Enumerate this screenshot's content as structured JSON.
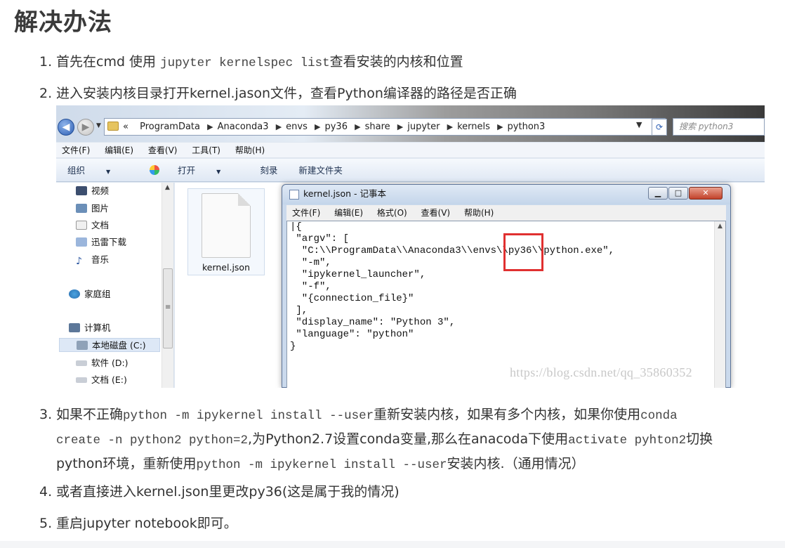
{
  "heading": "解决办法",
  "steps": {
    "s1": {
      "num": "1.",
      "pre": "首先在cmd 使用",
      "code": "jupyter kernelspec list",
      "post": "查看安装的内核和位置"
    },
    "s2": {
      "num": "2.",
      "text": "进入安装内核目录打开kernel.jason文件，查看Python编译器的路径是否正确"
    },
    "s3": {
      "num": "3.",
      "a": "如果不正确",
      "code1": "python -m ipykernel install --user",
      "b": "重新安装内核，如果有多个内核，如果你使用",
      "code2a": "conda",
      "code2b": "create -n python2 python=2",
      "c": ",为Python2.7设置conda变量,那么在anacoda下使用",
      "code3": "activate pyhton2",
      "d": "切换",
      "e": "python环境，重新使用",
      "code4": "python -m ipykernel install --user",
      "f": "安装内核.（通用情况）"
    },
    "s4": {
      "num": "4.",
      "text": "或者直接进入kernel.json里更改py36(这是属于我的情况)"
    },
    "s5": {
      "num": "5.",
      "text": "重启jupyter notebook即可。"
    }
  },
  "explorer": {
    "path_prefix": "«",
    "path": [
      "ProgramData",
      "Anaconda3",
      "envs",
      "py36",
      "share",
      "jupyter",
      "kernels",
      "python3"
    ],
    "search_placeholder": "搜索 python3",
    "menu": [
      "文件(F)",
      "编辑(E)",
      "查看(V)",
      "工具(T)",
      "帮助(H)"
    ],
    "toolbar": {
      "organize": "组织",
      "open": "打开",
      "burn": "刻录",
      "new_folder": "新建文件夹"
    },
    "nav": [
      "视频",
      "图片",
      "文档",
      "迅雷下载",
      "音乐",
      "家庭组",
      "计算机",
      "本地磁盘 (C:)",
      "软件 (D:)",
      "文档 (E:)"
    ],
    "file_name": "kernel.json"
  },
  "notepad": {
    "title": "kernel.json - 记事本",
    "menu": [
      "文件(F)",
      "编辑(E)",
      "格式(O)",
      "查看(V)",
      "帮助(H)"
    ],
    "content": "|{\n \"argv\": [\n  \"C:\\\\ProgramData\\\\Anaconda3\\\\envs\\\\py36\\\\python.exe\",\n  \"-m\",\n  \"ipykernel_launcher\",\n  \"-f\",\n  \"{connection_file}\"\n ],\n \"display_name\": \"Python 3\",\n \"language\": \"python\"\n}"
  },
  "watermark": "https://blog.csdn.net/qq_35860352",
  "colors": {
    "highlight_box": "#e03030",
    "heading": "#3a3a3a",
    "text": "#333333"
  }
}
